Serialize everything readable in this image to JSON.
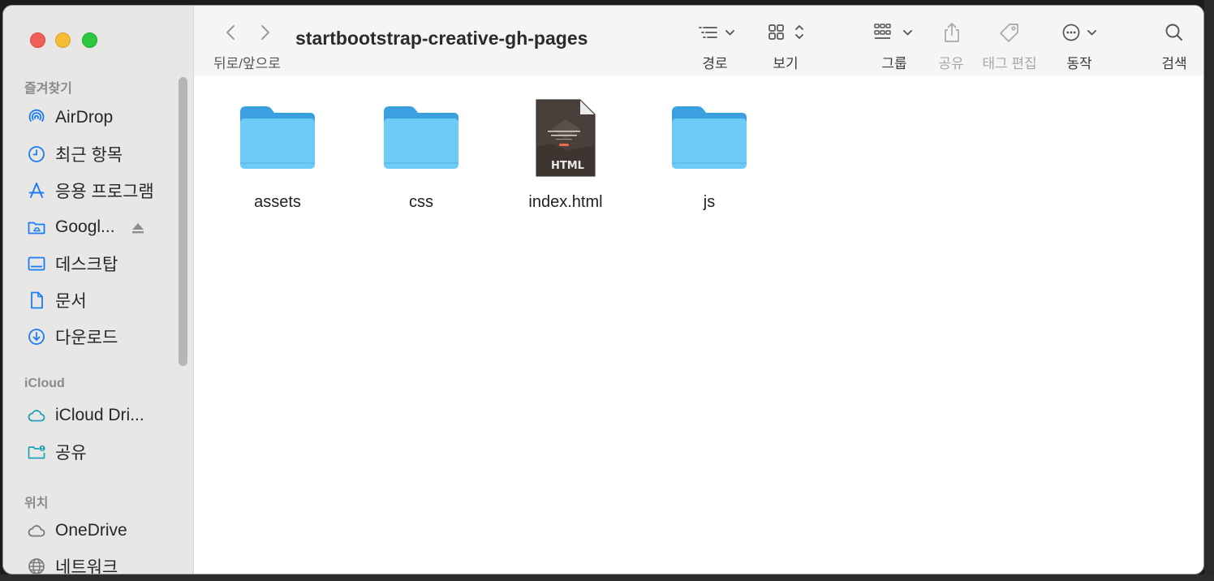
{
  "window": {
    "title": "startbootstrap-creative-gh-pages"
  },
  "toolbar": {
    "nav_label": "뒤로/앞으로",
    "path_label": "경로",
    "view_label": "보기",
    "group_label": "그룹",
    "share_label": "공유",
    "tags_label": "태그 편집",
    "action_label": "동작",
    "search_label": "검색"
  },
  "sidebar": {
    "favorites_header": "즐겨찾기",
    "favorites": [
      {
        "label": "AirDrop",
        "icon": "airdrop-icon"
      },
      {
        "label": "최근 항목",
        "icon": "clock-icon"
      },
      {
        "label": "응용 프로그램",
        "icon": "applications-icon"
      },
      {
        "label": "Googl...",
        "icon": "google-drive-icon"
      },
      {
        "label": "데스크탑",
        "icon": "desktop-icon"
      },
      {
        "label": "문서",
        "icon": "document-icon"
      },
      {
        "label": "다운로드",
        "icon": "download-icon"
      }
    ],
    "icloud_header": "iCloud",
    "icloud": [
      {
        "label": "iCloud Dri...",
        "icon": "icloud-icon"
      },
      {
        "label": "공유",
        "icon": "shared-folder-icon"
      }
    ],
    "locations_header": "위치",
    "locations": [
      {
        "label": "OneDrive",
        "icon": "cloud-icon"
      },
      {
        "label": "네트워크",
        "icon": "network-icon"
      }
    ]
  },
  "files": [
    {
      "name": "assets",
      "type": "folder"
    },
    {
      "name": "css",
      "type": "folder"
    },
    {
      "name": "index.html",
      "type": "html",
      "badge": "HTML"
    },
    {
      "name": "js",
      "type": "folder"
    }
  ],
  "colors": {
    "accent": "#1a7cf4",
    "folder": "#6ecbf7",
    "folder_tab": "#3aa0e0",
    "sidebar_bg": "#e9e7e6"
  }
}
